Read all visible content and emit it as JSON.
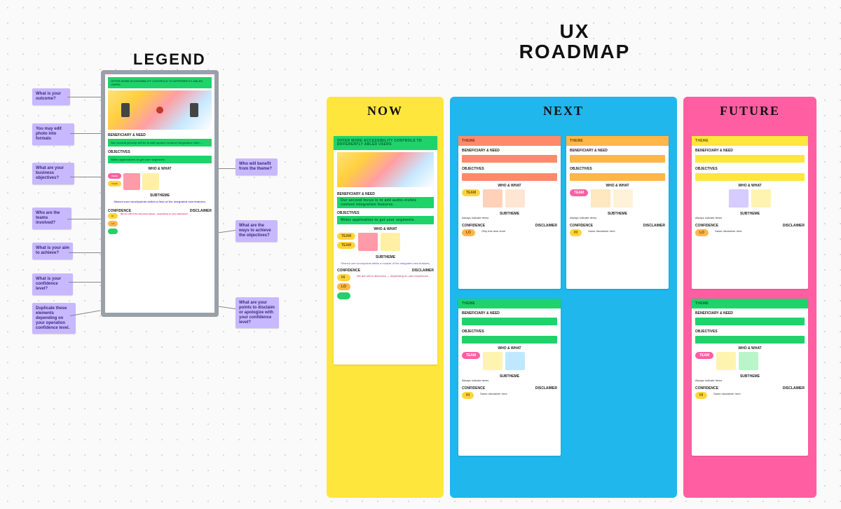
{
  "legend": {
    "title": "LEGEND",
    "card": {
      "theme_label": "OFFER MORE ACCESSIBILITY CONTROLS TO DIFFERENTLY ABLED USERS",
      "beneficiary_heading": "BENEFICIARY & NEED",
      "beneficiary_body": "Our second priority will be to add spoken content integration, then ...",
      "objectives_heading": "OBJECTIVES",
      "objectives_body": "Wider applications to get user segments.",
      "who_heading": "WHO & WHAT",
      "team_label": "TEAM",
      "subtheme_heading": "SUBTHEME",
      "subtheme_body": "Shared user touchpoints within a field of the integrated new features.",
      "confidence_heading": "CONFIDENCE",
      "disclaimer_heading": "DISCLAIMER",
      "disclaimer_body": "We are still in the discovery phase – depending on user experience.",
      "hi_label": "HI",
      "lo_label": "LO"
    },
    "stickies": {
      "outcome": "What is your outcome?",
      "format": "You may edit photo into formats",
      "business": "What are your business objectives?",
      "involved": "Who are the teams involved?",
      "aim": "What is your aim to achieve?",
      "confidence": "What is your confidence level?",
      "duplicate": "Duplicate these elements depending on your operation confidence level.",
      "benefit": "Who will benefit from the theme?",
      "ways": "What are the ways to achieve the objectives?",
      "disclaimer": "What are your points to disclaim or apologize with your confidence level?"
    }
  },
  "roadmap": {
    "title_line1": "UX",
    "title_line2": "ROADMAP",
    "now_label": "NOW",
    "next_label": "NEXT",
    "future_label": "FUTURE"
  },
  "card_labels": {
    "theme": "THEME",
    "beneficiary": "BENEFICIARY & NEED",
    "objectives": "OBJECTIVES",
    "who": "WHO & WHAT",
    "team": "TEAM",
    "subtheme": "SUBTHEME",
    "confidence": "CONFIDENCE",
    "disclaimer": "DISCLAIMER",
    "hi": "HI",
    "lo": "LO"
  },
  "now_card": {
    "theme_text": "OFFER MORE ACCESSIBILITY CONTROLS TO DIFFERENTLY ABLED USERS",
    "beneficiary_body": "Our second focus is to add audio-visible content integration features.",
    "objectives_body": "Wider application to get user segments.",
    "subtheme_body": "Shared user touchpoints within a module of the integrated new features.",
    "disclaimer_body": "We are still in discovery — depending on user experience."
  },
  "next_disclaimer": "Only this time done",
  "generic_subtheme": "Always indicate items",
  "generic_disclaimer": "Same disclaimer here"
}
